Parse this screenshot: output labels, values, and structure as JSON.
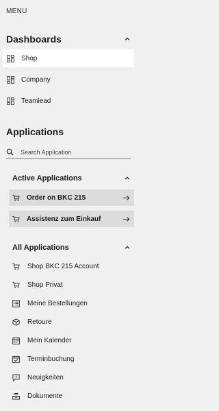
{
  "menu": {
    "title": "MENU"
  },
  "dashboards": {
    "title": "Dashboards",
    "items": [
      {
        "label": "Shop",
        "icon": "dashboard-icon",
        "active": true
      },
      {
        "label": "Company",
        "icon": "dashboard-icon"
      },
      {
        "label": "Teamlead",
        "icon": "dashboard-icon"
      }
    ]
  },
  "applications": {
    "title": "Applications",
    "search": {
      "placeholder": "Search Application",
      "value": ""
    },
    "active": {
      "title": "Active Applications",
      "items": [
        {
          "label": "Order on BKC 215",
          "icon": "cart-icon"
        },
        {
          "label": "Assistenz zum Einkauf",
          "icon": "cart-icon"
        }
      ]
    },
    "all": {
      "title": "All Applications",
      "items": [
        {
          "label": "Shop BKC 215 Account",
          "icon": "cart-icon"
        },
        {
          "label": "Shop Privat",
          "icon": "cart-icon"
        },
        {
          "label": "Meine Bestellungen",
          "icon": "list-icon"
        },
        {
          "label": "Retoure",
          "icon": "return-box-icon"
        },
        {
          "label": "Mein Kalender",
          "icon": "calendar-icon"
        },
        {
          "label": "Terminbuchung",
          "icon": "calendar-booking-icon"
        },
        {
          "label": "Neuigkeiten",
          "icon": "news-icon"
        },
        {
          "label": "Dokumente",
          "icon": "documents-icon"
        }
      ]
    }
  },
  "colors": {
    "background": "#f0f0f0",
    "active_item_bg": "#ffffff",
    "active_app_bg": "#dcdcdc",
    "text": "#1a1a1a"
  }
}
